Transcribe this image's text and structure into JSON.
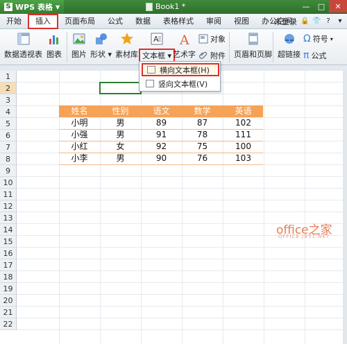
{
  "titlebar": {
    "app_name": "WPS 表格",
    "doc_title": "Book1 *"
  },
  "menu": {
    "items": [
      "开始",
      "插入",
      "页面布局",
      "公式",
      "数据",
      "表格样式",
      "审阅",
      "视图",
      "办公空间"
    ],
    "login": "未登录"
  },
  "ribbon": {
    "pivot": "数据透视表",
    "chart": "图表",
    "picture": "图片",
    "shapes": "形状",
    "clipart": "素材库",
    "textbox": "文本框",
    "wordart": "艺术字",
    "object": "对象",
    "attachment": "附件",
    "header_footer": "页眉和页脚",
    "hyperlink": "超链接",
    "symbol": "符号",
    "formula": "公式"
  },
  "dropdown": {
    "horizontal": "横向文本框(H)",
    "vertical": "竖向文本框(V)"
  },
  "rows": [
    "1",
    "2",
    "3",
    "4",
    "5",
    "6",
    "7",
    "8",
    "9",
    "10",
    "11",
    "12",
    "13",
    "14",
    "15",
    "16",
    "17",
    "18",
    "19",
    "20",
    "21",
    "22"
  ],
  "table": {
    "headers": [
      "姓名",
      "性别",
      "语文",
      "数学",
      "英语"
    ],
    "data": [
      [
        "小明",
        "男",
        "89",
        "87",
        "102"
      ],
      [
        "小强",
        "男",
        "91",
        "78",
        "111"
      ],
      [
        "小红",
        "女",
        "92",
        "75",
        "100"
      ],
      [
        "小李",
        "男",
        "90",
        "76",
        "103"
      ]
    ]
  },
  "watermark": {
    "main": "office之家",
    "sub": "OFFICE.JB51.NET"
  },
  "colors": {
    "accent_green": "#2f6f2c",
    "header_orange": "#f6a257",
    "highlight_red": "#d9302a"
  }
}
